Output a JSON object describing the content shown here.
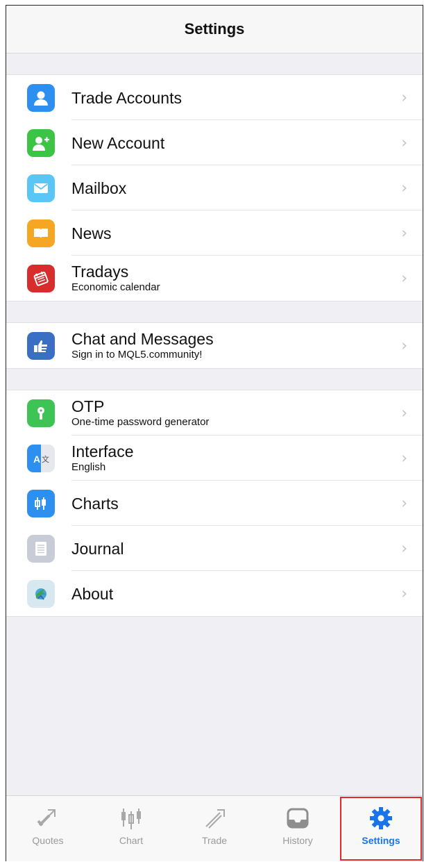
{
  "navbar": {
    "title": "Settings"
  },
  "groups": [
    {
      "items": [
        {
          "label": "Trade Accounts",
          "sub": "",
          "icon": "person-icon",
          "color": "#2d8ff0"
        },
        {
          "label": "New Account",
          "sub": "",
          "icon": "add-person-icon",
          "color": "#3cc544"
        },
        {
          "label": "Mailbox",
          "sub": "",
          "icon": "mail-icon",
          "color": "#5ac6f5"
        },
        {
          "label": "News",
          "sub": "",
          "icon": "book-icon",
          "color": "#f5a623"
        },
        {
          "label": "Tradays",
          "sub": "Economic calendar",
          "icon": "calendar-icon",
          "color": "#d72d2d"
        }
      ]
    },
    {
      "items": [
        {
          "label": "Chat and Messages",
          "sub": "Sign in to MQL5.community!",
          "icon": "thumbs-up-icon",
          "color": "#3b6fc4"
        }
      ]
    },
    {
      "items": [
        {
          "label": "OTP",
          "sub": "One-time password generator",
          "icon": "key-icon",
          "color": "#3ec455"
        },
        {
          "label": "Interface",
          "sub": "English",
          "icon": "translate-icon",
          "color": "#2d8ff0"
        },
        {
          "label": "Charts",
          "sub": "",
          "icon": "candlestick-icon",
          "color": "#2d8ff0"
        },
        {
          "label": "Journal",
          "sub": "",
          "icon": "journal-icon",
          "color": "#c8ccd6"
        },
        {
          "label": "About",
          "sub": "",
          "icon": "mt-logo-icon",
          "color": "#d8e8f0"
        }
      ]
    }
  ],
  "tabbar": {
    "tabs": [
      {
        "label": "Quotes",
        "icon": "quotes-icon",
        "active": false
      },
      {
        "label": "Chart",
        "icon": "chart-candles-icon",
        "active": false
      },
      {
        "label": "Trade",
        "icon": "trade-icon",
        "active": false
      },
      {
        "label": "History",
        "icon": "history-inbox-icon",
        "active": false
      },
      {
        "label": "Settings",
        "icon": "gear-icon",
        "active": true
      }
    ],
    "active_color": "#1a73e8",
    "inactive_color": "#9a9a9a"
  }
}
